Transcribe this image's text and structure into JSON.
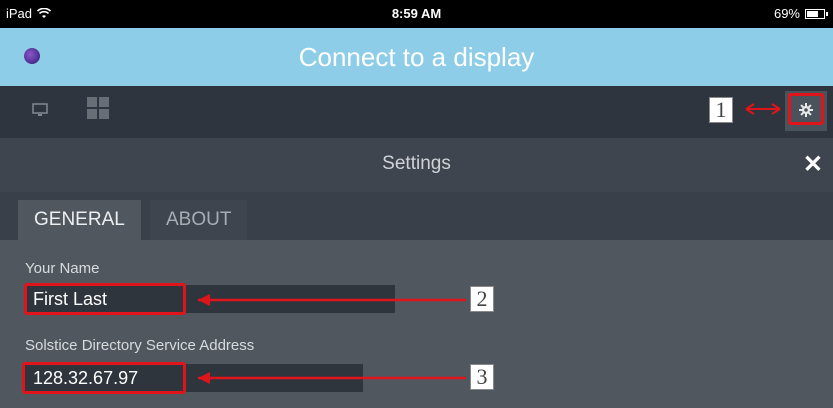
{
  "status_bar": {
    "device": "iPad",
    "wifi_icon": "wifi-icon",
    "time": "8:59 AM",
    "battery_percent": "69%",
    "battery_level": 0.69
  },
  "header": {
    "title": "Connect to a display",
    "logo_icon": "solstice-logo-icon"
  },
  "toolbar": {
    "icons": [
      "display-icon",
      "grid-icon",
      "gear-icon"
    ]
  },
  "annotations": {
    "callout_1": "1",
    "callout_2": "2",
    "callout_3": "3",
    "highlight_color": "#e0151c"
  },
  "settings": {
    "title": "Settings",
    "close_icon": "close-icon",
    "tabs": [
      {
        "label": "GENERAL",
        "active": true
      },
      {
        "label": "ABOUT",
        "active": false
      }
    ],
    "fields": {
      "name": {
        "label": "Your Name",
        "value": "First Last"
      },
      "directory": {
        "label": "Solstice Directory Service Address",
        "value": "128.32.67.97"
      }
    }
  },
  "colors": {
    "header_bg": "#8ecde8",
    "toolbar_bg": "#2e353e",
    "panel_bg": "#50575f"
  }
}
